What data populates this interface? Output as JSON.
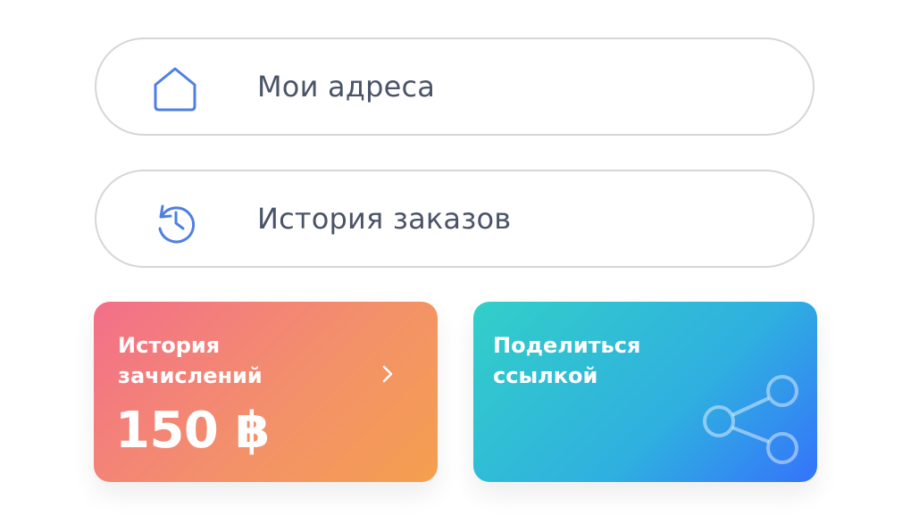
{
  "menu": {
    "addresses": {
      "label": "Мои адреса",
      "icon": "home-icon"
    },
    "orders": {
      "label": "История заказов",
      "icon": "history-icon"
    }
  },
  "bonus_card": {
    "title": "История зачислений",
    "amount": "150 ฿",
    "icon": "chevron-right-icon"
  },
  "share_card": {
    "title": "Поделиться ссылкой",
    "icon": "share-icon"
  },
  "colors": {
    "accent_blue": "#4f80e1",
    "label_text": "#4a5468",
    "bonus_gradient": [
      "#f36f8a",
      "#f49f4e"
    ],
    "share_gradient": [
      "#32cfc8",
      "#3573fb"
    ]
  }
}
